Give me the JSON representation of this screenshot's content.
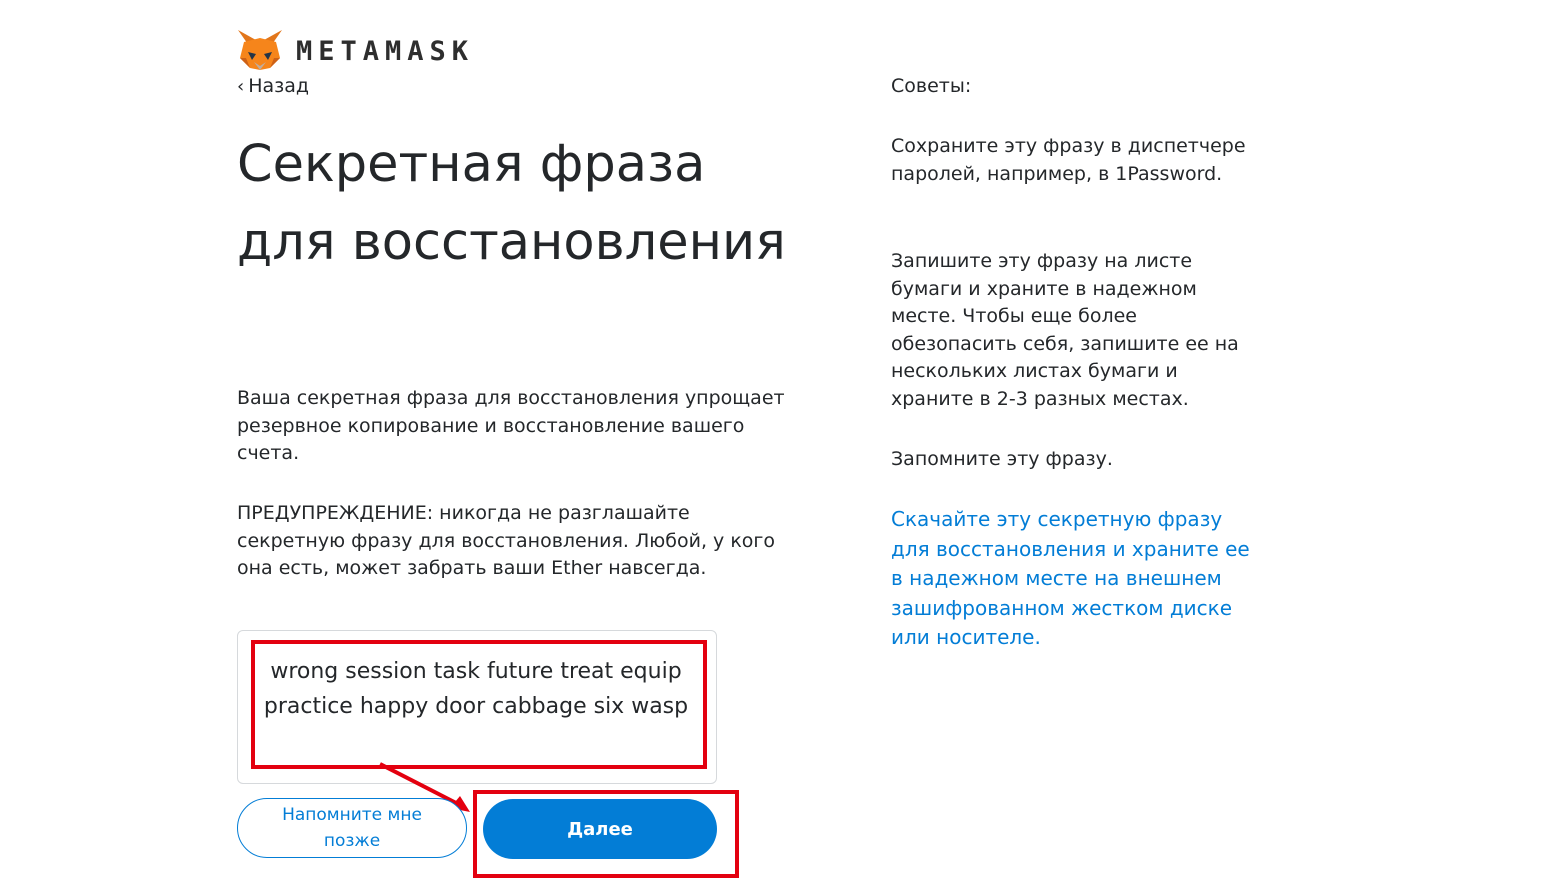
{
  "header": {
    "brand": "METAMASK",
    "back_label": "Назад"
  },
  "main": {
    "title": "Секретная фраза для восстановления",
    "description": "Ваша секретная фраза для восстановления упрощает резервное копирование и восстановление вашего счета.",
    "warning": "ПРЕДУПРЕЖДЕНИЕ: никогда не разглашайте секретную фразу для восстановления. Любой, у кого она есть, может забрать ваши Ether навсегда.",
    "phrase": "wrong session task future treat equip practice happy door cabbage six wasp",
    "remind_later_label": "Напомните мне позже",
    "next_label": "Далее"
  },
  "tips": {
    "title": "Советы:",
    "tip1": "Сохраните эту фразу в диспетчере паролей, например, в 1Password.",
    "tip2": "Запишите эту фразу на листе бумаги и храните в надежном месте. Чтобы еще более обезопасить себя, запишите ее на нескольких листах бумаги и храните в 2-3 разных местах.",
    "tip3": "Запомните эту фразу.",
    "download_link": "Скачайте эту секретную фразу для восстановления и храните ее в надежном месте на внешнем зашифрованном жестком диске или носителе."
  },
  "colors": {
    "accent": "#037dd6",
    "highlight": "#e3000f",
    "fox": "#e2761b"
  }
}
